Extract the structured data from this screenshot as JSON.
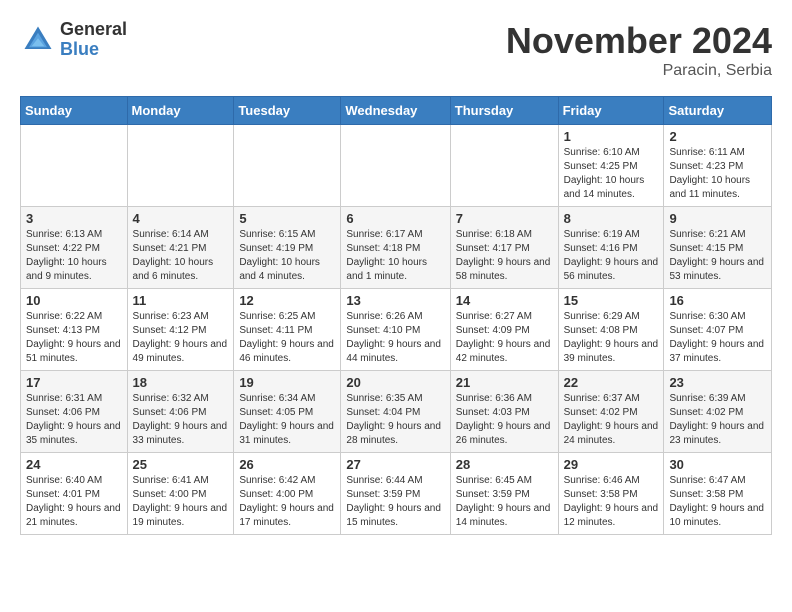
{
  "header": {
    "logo_general": "General",
    "logo_blue": "Blue",
    "month_title": "November 2024",
    "location": "Paracin, Serbia"
  },
  "weekdays": [
    "Sunday",
    "Monday",
    "Tuesday",
    "Wednesday",
    "Thursday",
    "Friday",
    "Saturday"
  ],
  "weeks": [
    [
      {
        "day": "",
        "info": ""
      },
      {
        "day": "",
        "info": ""
      },
      {
        "day": "",
        "info": ""
      },
      {
        "day": "",
        "info": ""
      },
      {
        "day": "",
        "info": ""
      },
      {
        "day": "1",
        "info": "Sunrise: 6:10 AM\nSunset: 4:25 PM\nDaylight: 10 hours and 14 minutes."
      },
      {
        "day": "2",
        "info": "Sunrise: 6:11 AM\nSunset: 4:23 PM\nDaylight: 10 hours and 11 minutes."
      }
    ],
    [
      {
        "day": "3",
        "info": "Sunrise: 6:13 AM\nSunset: 4:22 PM\nDaylight: 10 hours and 9 minutes."
      },
      {
        "day": "4",
        "info": "Sunrise: 6:14 AM\nSunset: 4:21 PM\nDaylight: 10 hours and 6 minutes."
      },
      {
        "day": "5",
        "info": "Sunrise: 6:15 AM\nSunset: 4:19 PM\nDaylight: 10 hours and 4 minutes."
      },
      {
        "day": "6",
        "info": "Sunrise: 6:17 AM\nSunset: 4:18 PM\nDaylight: 10 hours and 1 minute."
      },
      {
        "day": "7",
        "info": "Sunrise: 6:18 AM\nSunset: 4:17 PM\nDaylight: 9 hours and 58 minutes."
      },
      {
        "day": "8",
        "info": "Sunrise: 6:19 AM\nSunset: 4:16 PM\nDaylight: 9 hours and 56 minutes."
      },
      {
        "day": "9",
        "info": "Sunrise: 6:21 AM\nSunset: 4:15 PM\nDaylight: 9 hours and 53 minutes."
      }
    ],
    [
      {
        "day": "10",
        "info": "Sunrise: 6:22 AM\nSunset: 4:13 PM\nDaylight: 9 hours and 51 minutes."
      },
      {
        "day": "11",
        "info": "Sunrise: 6:23 AM\nSunset: 4:12 PM\nDaylight: 9 hours and 49 minutes."
      },
      {
        "day": "12",
        "info": "Sunrise: 6:25 AM\nSunset: 4:11 PM\nDaylight: 9 hours and 46 minutes."
      },
      {
        "day": "13",
        "info": "Sunrise: 6:26 AM\nSunset: 4:10 PM\nDaylight: 9 hours and 44 minutes."
      },
      {
        "day": "14",
        "info": "Sunrise: 6:27 AM\nSunset: 4:09 PM\nDaylight: 9 hours and 42 minutes."
      },
      {
        "day": "15",
        "info": "Sunrise: 6:29 AM\nSunset: 4:08 PM\nDaylight: 9 hours and 39 minutes."
      },
      {
        "day": "16",
        "info": "Sunrise: 6:30 AM\nSunset: 4:07 PM\nDaylight: 9 hours and 37 minutes."
      }
    ],
    [
      {
        "day": "17",
        "info": "Sunrise: 6:31 AM\nSunset: 4:06 PM\nDaylight: 9 hours and 35 minutes."
      },
      {
        "day": "18",
        "info": "Sunrise: 6:32 AM\nSunset: 4:06 PM\nDaylight: 9 hours and 33 minutes."
      },
      {
        "day": "19",
        "info": "Sunrise: 6:34 AM\nSunset: 4:05 PM\nDaylight: 9 hours and 31 minutes."
      },
      {
        "day": "20",
        "info": "Sunrise: 6:35 AM\nSunset: 4:04 PM\nDaylight: 9 hours and 28 minutes."
      },
      {
        "day": "21",
        "info": "Sunrise: 6:36 AM\nSunset: 4:03 PM\nDaylight: 9 hours and 26 minutes."
      },
      {
        "day": "22",
        "info": "Sunrise: 6:37 AM\nSunset: 4:02 PM\nDaylight: 9 hours and 24 minutes."
      },
      {
        "day": "23",
        "info": "Sunrise: 6:39 AM\nSunset: 4:02 PM\nDaylight: 9 hours and 23 minutes."
      }
    ],
    [
      {
        "day": "24",
        "info": "Sunrise: 6:40 AM\nSunset: 4:01 PM\nDaylight: 9 hours and 21 minutes."
      },
      {
        "day": "25",
        "info": "Sunrise: 6:41 AM\nSunset: 4:00 PM\nDaylight: 9 hours and 19 minutes."
      },
      {
        "day": "26",
        "info": "Sunrise: 6:42 AM\nSunset: 4:00 PM\nDaylight: 9 hours and 17 minutes."
      },
      {
        "day": "27",
        "info": "Sunrise: 6:44 AM\nSunset: 3:59 PM\nDaylight: 9 hours and 15 minutes."
      },
      {
        "day": "28",
        "info": "Sunrise: 6:45 AM\nSunset: 3:59 PM\nDaylight: 9 hours and 14 minutes."
      },
      {
        "day": "29",
        "info": "Sunrise: 6:46 AM\nSunset: 3:58 PM\nDaylight: 9 hours and 12 minutes."
      },
      {
        "day": "30",
        "info": "Sunrise: 6:47 AM\nSunset: 3:58 PM\nDaylight: 9 hours and 10 minutes."
      }
    ]
  ]
}
